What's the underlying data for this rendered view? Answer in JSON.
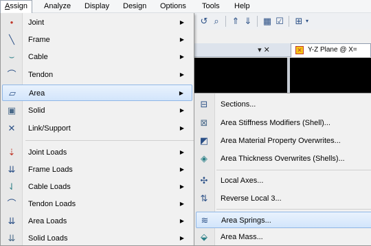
{
  "menubar": {
    "items": [
      {
        "label": "Assign",
        "accel": "A",
        "rest": "ssign",
        "active": true
      },
      {
        "label": "Analyze"
      },
      {
        "label": "Display"
      },
      {
        "label": "Design"
      },
      {
        "label": "Options"
      },
      {
        "label": "Tools"
      },
      {
        "label": "Help"
      }
    ]
  },
  "toolbar": {
    "icons": [
      "undo-icon",
      "binoculars-icon",
      "move-up-icon",
      "move-down-icon",
      "snap-icon",
      "checkbox-icon",
      "view-options-icon"
    ]
  },
  "pane": {
    "close_label": "▾ ✕",
    "view_tab_title": "Y-Z Plane @ X="
  },
  "assign_menu": {
    "items": [
      {
        "label": "Joint",
        "icon": "joint-icon",
        "glyph": "•",
        "color": "#c0392b",
        "submenu": true
      },
      {
        "label": "Frame",
        "icon": "frame-icon",
        "glyph": "╲",
        "color": "#2a4f86",
        "submenu": true
      },
      {
        "label": "Cable",
        "icon": "cable-icon",
        "glyph": "⌣",
        "color": "#2a7f86",
        "submenu": true
      },
      {
        "label": "Tendon",
        "icon": "tendon-icon",
        "glyph": "⌒",
        "color": "#2a4f86",
        "submenu": true
      },
      {
        "label": "Area",
        "icon": "area-icon",
        "glyph": "▱",
        "color": "#2a4f86",
        "submenu": true,
        "highlighted": true
      },
      {
        "label": "Solid",
        "icon": "solid-icon",
        "glyph": "▣",
        "color": "#4a6a8a",
        "submenu": true
      },
      {
        "label": "Link/Support",
        "icon": "link-support-icon",
        "glyph": "✕",
        "color": "#2a4f86",
        "submenu": true
      },
      {
        "label": "Joint Loads",
        "icon": "joint-loads-icon",
        "glyph": "⇣",
        "color": "#c0392b",
        "submenu": true
      },
      {
        "label": "Frame Loads",
        "icon": "frame-loads-icon",
        "glyph": "⇊",
        "color": "#2a4f86",
        "submenu": true
      },
      {
        "label": "Cable Loads",
        "icon": "cable-loads-icon",
        "glyph": "⇃",
        "color": "#2a7f86",
        "submenu": true
      },
      {
        "label": "Tendon Loads",
        "icon": "tendon-loads-icon",
        "glyph": "⌒",
        "color": "#2a4f86",
        "submenu": true
      },
      {
        "label": "Area Loads",
        "icon": "area-loads-icon",
        "glyph": "⇊",
        "color": "#2a4f86",
        "submenu": true
      },
      {
        "label": "Solid Loads",
        "icon": "solid-loads-icon",
        "glyph": "⇊",
        "color": "#4a6a8a",
        "submenu": true
      }
    ]
  },
  "area_submenu": {
    "items": [
      {
        "label": "Sections...",
        "icon": "sections-icon",
        "glyph": "⊟",
        "color": "#2a4f86"
      },
      {
        "label": "Area Stiffness Modifiers (Shell)...",
        "icon": "stiffness-modifiers-icon",
        "glyph": "⊠",
        "color": "#4a6a8a"
      },
      {
        "label": "Area Material Property Overwrites...",
        "icon": "material-overwrites-icon",
        "glyph": "◩",
        "color": "#2a4f86"
      },
      {
        "label": "Area Thickness Overwrites (Shells)...",
        "icon": "thickness-overwrites-icon",
        "glyph": "◈",
        "color": "#2a7f86"
      },
      {
        "label": "Local Axes...",
        "icon": "local-axes-icon",
        "glyph": "✣",
        "color": "#2a4f86"
      },
      {
        "label": "Reverse Local 3...",
        "icon": "reverse-local-icon",
        "glyph": "⇅",
        "color": "#2a4f86"
      },
      {
        "label": "Area Springs...",
        "icon": "area-springs-icon",
        "glyph": "≋",
        "color": "#2a4f86",
        "highlighted": true
      },
      {
        "label": "Area Mass...",
        "icon": "area-mass-icon",
        "glyph": "⬙",
        "color": "#2a7f86"
      }
    ]
  }
}
